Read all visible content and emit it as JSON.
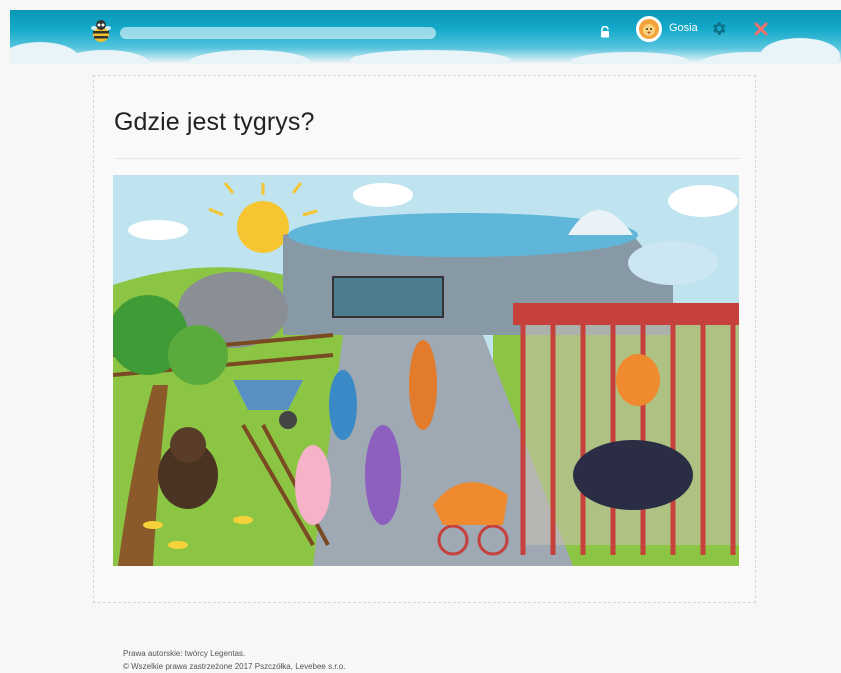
{
  "header": {
    "user_name": "Gosia",
    "logo_icon": "bee-icon",
    "lock_icon": "lock-icon",
    "avatar_icon": "lion-avatar",
    "settings_icon": "gear-icon",
    "close_icon": "close-icon",
    "colors": {
      "bar": "#14a9c9",
      "gear": "#0e6f86",
      "close": "#ef6f6f"
    }
  },
  "main": {
    "question": "Gdzie jest tygrys?",
    "image": "zoo-scene-illustration"
  },
  "footer": {
    "line1": "Prawa autorskie: twórcy Legentas.",
    "line2": "© Wszelkie prawa zastrzeżone 2017 Pszczółka, Levebee s.r.o."
  }
}
